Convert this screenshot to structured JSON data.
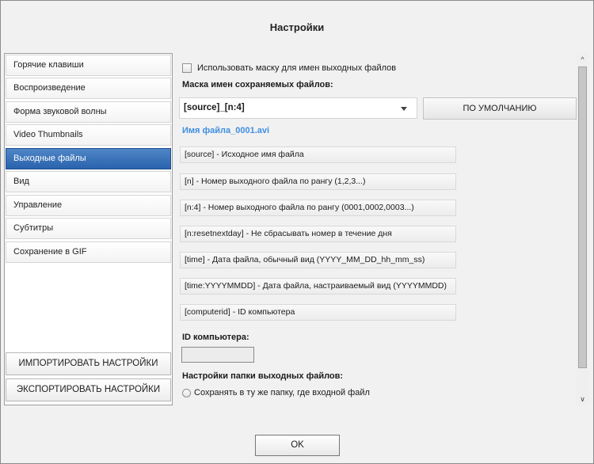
{
  "window": {
    "title": "Настройки"
  },
  "sidebar": {
    "items": [
      {
        "label": "Горячие клавиши",
        "active": false
      },
      {
        "label": "Воспроизведение",
        "active": false
      },
      {
        "label": "Форма звуковой волны",
        "active": false
      },
      {
        "label": "Video Thumbnails",
        "active": false
      },
      {
        "label": "Выходные файлы",
        "active": true
      },
      {
        "label": "Вид",
        "active": false
      },
      {
        "label": "Управление",
        "active": false
      },
      {
        "label": "Субтитры",
        "active": false
      },
      {
        "label": "Сохранение в GIF",
        "active": false
      }
    ],
    "import_label": "ИМПОРТИРОВАТЬ НАСТРОЙКИ",
    "export_label": "ЭКСПОРТИРОВАТЬ НАСТРОЙКИ"
  },
  "main": {
    "use_mask": {
      "label": "Использовать маску для имен выходных файлов",
      "checked": false
    },
    "mask_label": "Маска имен сохраняемых файлов:",
    "mask_value": "[source]_[n:4]",
    "default_label": "ПО УМОЛЧАНИЮ",
    "preview": "Имя файла_0001.avi",
    "tokens": [
      "[source] - Исходное имя файла",
      "[n] - Номер выходного файла по рангу (1,2,3...)",
      "[n:4] - Номер выходного файла по рангу (0001,0002,0003...)",
      "[n:resetnextday] - Не сбрасывать номер в течение дня",
      "[time] - Дата файла, обычный вид (YYYY_MM_DD_hh_mm_ss)",
      "[time:YYYYMMDD] - Дата файла, настраиваемый вид (YYYYMMDD)",
      "[computerid] - ID компьютера"
    ],
    "computer_id_label": "ID компьютера:",
    "computer_id_value": "",
    "folder_label": "Настройки папки выходных файлов:",
    "folder_option": {
      "label": "Сохранять в ту же папку, где входной файл",
      "selected": false
    }
  },
  "footer": {
    "ok_label": "OK"
  },
  "colors": {
    "accent": "#2f69b3",
    "preview_link": "#3f8fe0"
  }
}
